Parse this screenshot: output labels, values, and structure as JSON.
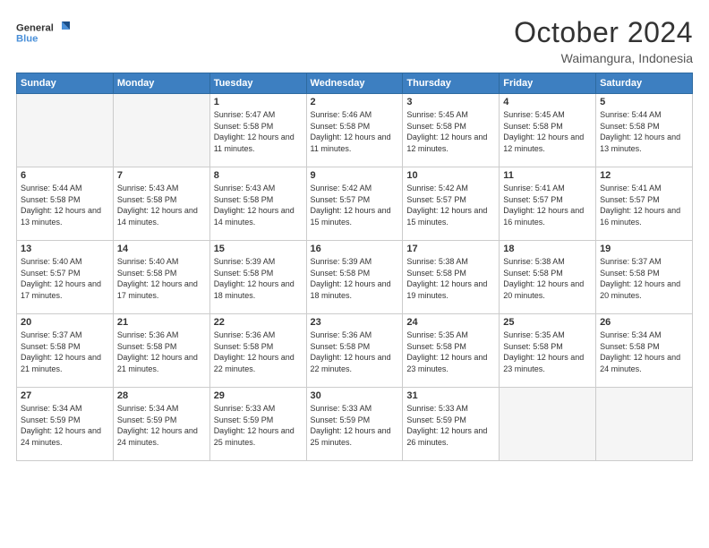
{
  "logo": {
    "line1": "General",
    "line2": "Blue"
  },
  "title": "October 2024",
  "location": "Waimangura, Indonesia",
  "days_of_week": [
    "Sunday",
    "Monday",
    "Tuesday",
    "Wednesday",
    "Thursday",
    "Friday",
    "Saturday"
  ],
  "weeks": [
    [
      {
        "day": "",
        "empty": true
      },
      {
        "day": "",
        "empty": true
      },
      {
        "day": "1",
        "sunrise": "Sunrise: 5:47 AM",
        "sunset": "Sunset: 5:58 PM",
        "daylight": "Daylight: 12 hours and 11 minutes."
      },
      {
        "day": "2",
        "sunrise": "Sunrise: 5:46 AM",
        "sunset": "Sunset: 5:58 PM",
        "daylight": "Daylight: 12 hours and 11 minutes."
      },
      {
        "day": "3",
        "sunrise": "Sunrise: 5:45 AM",
        "sunset": "Sunset: 5:58 PM",
        "daylight": "Daylight: 12 hours and 12 minutes."
      },
      {
        "day": "4",
        "sunrise": "Sunrise: 5:45 AM",
        "sunset": "Sunset: 5:58 PM",
        "daylight": "Daylight: 12 hours and 12 minutes."
      },
      {
        "day": "5",
        "sunrise": "Sunrise: 5:44 AM",
        "sunset": "Sunset: 5:58 PM",
        "daylight": "Daylight: 12 hours and 13 minutes."
      }
    ],
    [
      {
        "day": "6",
        "sunrise": "Sunrise: 5:44 AM",
        "sunset": "Sunset: 5:58 PM",
        "daylight": "Daylight: 12 hours and 13 minutes."
      },
      {
        "day": "7",
        "sunrise": "Sunrise: 5:43 AM",
        "sunset": "Sunset: 5:58 PM",
        "daylight": "Daylight: 12 hours and 14 minutes."
      },
      {
        "day": "8",
        "sunrise": "Sunrise: 5:43 AM",
        "sunset": "Sunset: 5:58 PM",
        "daylight": "Daylight: 12 hours and 14 minutes."
      },
      {
        "day": "9",
        "sunrise": "Sunrise: 5:42 AM",
        "sunset": "Sunset: 5:57 PM",
        "daylight": "Daylight: 12 hours and 15 minutes."
      },
      {
        "day": "10",
        "sunrise": "Sunrise: 5:42 AM",
        "sunset": "Sunset: 5:57 PM",
        "daylight": "Daylight: 12 hours and 15 minutes."
      },
      {
        "day": "11",
        "sunrise": "Sunrise: 5:41 AM",
        "sunset": "Sunset: 5:57 PM",
        "daylight": "Daylight: 12 hours and 16 minutes."
      },
      {
        "day": "12",
        "sunrise": "Sunrise: 5:41 AM",
        "sunset": "Sunset: 5:57 PM",
        "daylight": "Daylight: 12 hours and 16 minutes."
      }
    ],
    [
      {
        "day": "13",
        "sunrise": "Sunrise: 5:40 AM",
        "sunset": "Sunset: 5:57 PM",
        "daylight": "Daylight: 12 hours and 17 minutes."
      },
      {
        "day": "14",
        "sunrise": "Sunrise: 5:40 AM",
        "sunset": "Sunset: 5:58 PM",
        "daylight": "Daylight: 12 hours and 17 minutes."
      },
      {
        "day": "15",
        "sunrise": "Sunrise: 5:39 AM",
        "sunset": "Sunset: 5:58 PM",
        "daylight": "Daylight: 12 hours and 18 minutes."
      },
      {
        "day": "16",
        "sunrise": "Sunrise: 5:39 AM",
        "sunset": "Sunset: 5:58 PM",
        "daylight": "Daylight: 12 hours and 18 minutes."
      },
      {
        "day": "17",
        "sunrise": "Sunrise: 5:38 AM",
        "sunset": "Sunset: 5:58 PM",
        "daylight": "Daylight: 12 hours and 19 minutes."
      },
      {
        "day": "18",
        "sunrise": "Sunrise: 5:38 AM",
        "sunset": "Sunset: 5:58 PM",
        "daylight": "Daylight: 12 hours and 20 minutes."
      },
      {
        "day": "19",
        "sunrise": "Sunrise: 5:37 AM",
        "sunset": "Sunset: 5:58 PM",
        "daylight": "Daylight: 12 hours and 20 minutes."
      }
    ],
    [
      {
        "day": "20",
        "sunrise": "Sunrise: 5:37 AM",
        "sunset": "Sunset: 5:58 PM",
        "daylight": "Daylight: 12 hours and 21 minutes."
      },
      {
        "day": "21",
        "sunrise": "Sunrise: 5:36 AM",
        "sunset": "Sunset: 5:58 PM",
        "daylight": "Daylight: 12 hours and 21 minutes."
      },
      {
        "day": "22",
        "sunrise": "Sunrise: 5:36 AM",
        "sunset": "Sunset: 5:58 PM",
        "daylight": "Daylight: 12 hours and 22 minutes."
      },
      {
        "day": "23",
        "sunrise": "Sunrise: 5:36 AM",
        "sunset": "Sunset: 5:58 PM",
        "daylight": "Daylight: 12 hours and 22 minutes."
      },
      {
        "day": "24",
        "sunrise": "Sunrise: 5:35 AM",
        "sunset": "Sunset: 5:58 PM",
        "daylight": "Daylight: 12 hours and 23 minutes."
      },
      {
        "day": "25",
        "sunrise": "Sunrise: 5:35 AM",
        "sunset": "Sunset: 5:58 PM",
        "daylight": "Daylight: 12 hours and 23 minutes."
      },
      {
        "day": "26",
        "sunrise": "Sunrise: 5:34 AM",
        "sunset": "Sunset: 5:58 PM",
        "daylight": "Daylight: 12 hours and 24 minutes."
      }
    ],
    [
      {
        "day": "27",
        "sunrise": "Sunrise: 5:34 AM",
        "sunset": "Sunset: 5:59 PM",
        "daylight": "Daylight: 12 hours and 24 minutes."
      },
      {
        "day": "28",
        "sunrise": "Sunrise: 5:34 AM",
        "sunset": "Sunset: 5:59 PM",
        "daylight": "Daylight: 12 hours and 24 minutes."
      },
      {
        "day": "29",
        "sunrise": "Sunrise: 5:33 AM",
        "sunset": "Sunset: 5:59 PM",
        "daylight": "Daylight: 12 hours and 25 minutes."
      },
      {
        "day": "30",
        "sunrise": "Sunrise: 5:33 AM",
        "sunset": "Sunset: 5:59 PM",
        "daylight": "Daylight: 12 hours and 25 minutes."
      },
      {
        "day": "31",
        "sunrise": "Sunrise: 5:33 AM",
        "sunset": "Sunset: 5:59 PM",
        "daylight": "Daylight: 12 hours and 26 minutes."
      },
      {
        "day": "",
        "empty": true
      },
      {
        "day": "",
        "empty": true
      }
    ]
  ]
}
